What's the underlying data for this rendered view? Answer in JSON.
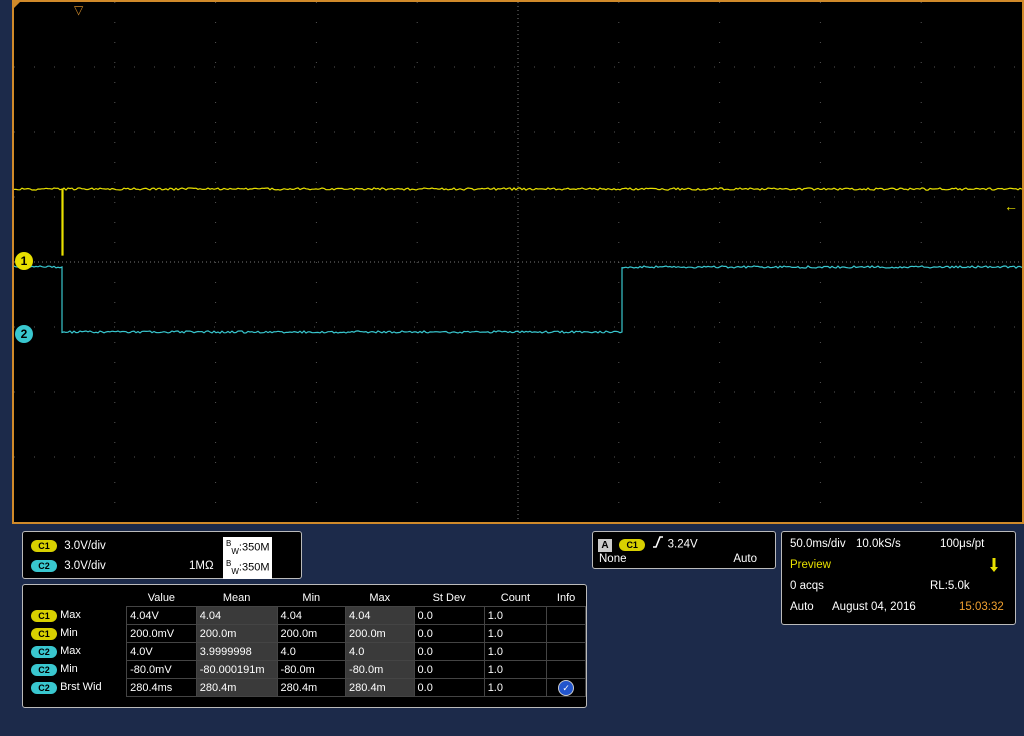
{
  "display": {
    "trigger_position_marker": "▽",
    "trigger_level_marker": "←",
    "channel_markers": [
      {
        "label": "1",
        "color": "#e8e000"
      },
      {
        "label": "2",
        "color": "#39c7cf"
      }
    ],
    "trace_colors": {
      "c1": "#e8e000",
      "c2": "#39c7cf"
    }
  },
  "channels": [
    {
      "badge": "C1",
      "scale": "3.0V/div",
      "impedance": "",
      "bw_b": "B",
      "bw_w": "W",
      "bw": ":350M"
    },
    {
      "badge": "C2",
      "scale": "3.0V/div",
      "impedance": "1MΩ",
      "bw_b": "B",
      "bw_w": "W",
      "bw": ":350M"
    }
  ],
  "measurements": {
    "headers": [
      "",
      "Value",
      "Mean",
      "Min",
      "Max",
      "St Dev",
      "Count",
      "Info"
    ],
    "rows": [
      {
        "ch": "C1",
        "name": "Max",
        "value": "4.04V",
        "mean": "4.04",
        "min": "4.04",
        "max": "4.04",
        "stdev": "0.0",
        "count": "1.0",
        "info": ""
      },
      {
        "ch": "C1",
        "name": "Min",
        "value": "200.0mV",
        "mean": "200.0m",
        "min": "200.0m",
        "max": "200.0m",
        "stdev": "0.0",
        "count": "1.0",
        "info": ""
      },
      {
        "ch": "C2",
        "name": "Max",
        "value": "4.0V",
        "mean": "3.9999998",
        "min": "4.0",
        "max": "4.0",
        "stdev": "0.0",
        "count": "1.0",
        "info": ""
      },
      {
        "ch": "C2",
        "name": "Min",
        "value": "-80.0mV",
        "mean": "-80.000191m",
        "min": "-80.0m",
        "max": "-80.0m",
        "stdev": "0.0",
        "count": "1.0",
        "info": ""
      },
      {
        "ch": "C2",
        "name": "Brst Wid",
        "value": "280.4ms",
        "mean": "280.4m",
        "min": "280.4m",
        "max": "280.4m",
        "stdev": "0.0",
        "count": "1.0",
        "info": "info-icon"
      }
    ]
  },
  "trigger": {
    "type_badge": "A",
    "source": "C1",
    "slope_icon": "rising-edge-icon",
    "level": "3.24V",
    "coupling": "None",
    "mode": "Auto"
  },
  "acquisition": {
    "timebase": "50.0ms/div",
    "sample_rate": "10.0kS/s",
    "resolution": "100μs/pt",
    "state": "Preview",
    "acqs": "0 acqs",
    "record_length": "RL:5.0k",
    "mode": "Auto",
    "date": "August 04, 2016",
    "time": "15:03:32",
    "time_color": "#f0a030"
  }
}
